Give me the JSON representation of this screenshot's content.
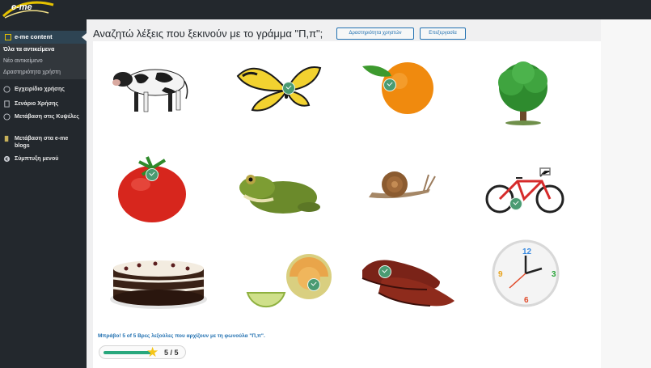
{
  "app": {
    "logo": "e-me",
    "brand_color": "#e6c200"
  },
  "sidebar": {
    "current_menu": "e-me content",
    "sub_items": [
      {
        "label": "Όλα τα αντικείμενα",
        "current": true
      },
      {
        "label": "Νέο αντικείμενο",
        "current": false
      },
      {
        "label": "Δραστηριότητα χρήστη",
        "current": false
      }
    ],
    "items": [
      {
        "label": "Εγχειρίδιο χρήσης",
        "icon": "help-circle-icon"
      },
      {
        "label": "Σενάριο Χρήσης",
        "icon": "document-icon"
      },
      {
        "label": "Μετάβαση στις Κυψέλες",
        "icon": "hive-icon"
      },
      {
        "label": "Μετάβαση στα e-me blogs",
        "icon": "blog-icon"
      },
      {
        "label": "Σύμπτυξη μενού",
        "icon": "collapse-icon"
      }
    ]
  },
  "header": {
    "title": "Αναζητώ λέξεις που ξεκινούν με το γράμμα \"Π,π\";",
    "user_activity_button": "Δραστηριότητα χρηστών",
    "edit_button": "Επεξεργασία"
  },
  "grid": {
    "cards": [
      {
        "name": "cow",
        "selected": false
      },
      {
        "name": "butterfly",
        "selected": true
      },
      {
        "name": "orange",
        "selected": true
      },
      {
        "name": "tree",
        "selected": false
      },
      {
        "name": "tomato",
        "selected": true
      },
      {
        "name": "frog",
        "selected": false
      },
      {
        "name": "snail",
        "selected": false
      },
      {
        "name": "bicycle",
        "selected": true
      },
      {
        "name": "cake",
        "selected": false
      },
      {
        "name": "melon",
        "selected": true
      },
      {
        "name": "shoes",
        "selected": true
      },
      {
        "name": "clock",
        "selected": false
      }
    ]
  },
  "feedback": {
    "message": "Μπράβο! 5 of 5 Βρες λεξούλες που αρχίζουν με τη φωνούλα \"Π,π\".",
    "score": "5 / 5",
    "progress": 1.0
  }
}
